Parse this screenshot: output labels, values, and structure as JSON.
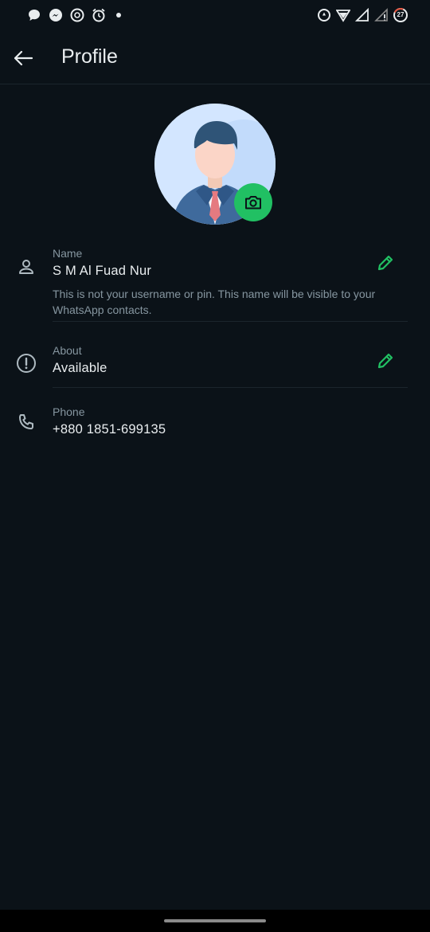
{
  "status_bar": {
    "left_icons": [
      "chat-bubble-icon",
      "messenger-icon",
      "openai-icon",
      "alarm-icon"
    ],
    "right_icons": [
      "data-saver-icon",
      "wifi-icon",
      "signal-icon",
      "signal-weak-icon"
    ],
    "battery_level": "27"
  },
  "header": {
    "title": "Profile"
  },
  "avatar": {
    "background_color": "#d3e6ff",
    "camera_button_color": "#21c063"
  },
  "profile": {
    "name": {
      "label": "Name",
      "value": "S M Al Fuad Nur",
      "description": "This is not your username or pin. This name will be visible to your WhatsApp contacts."
    },
    "about": {
      "label": "About",
      "value": "Available"
    },
    "phone": {
      "label": "Phone",
      "value": "+880 1851-699135"
    }
  },
  "colors": {
    "background": "#0b1218",
    "accent": "#21c063",
    "primary_text": "#e9edef",
    "secondary_text": "#8696a0"
  }
}
